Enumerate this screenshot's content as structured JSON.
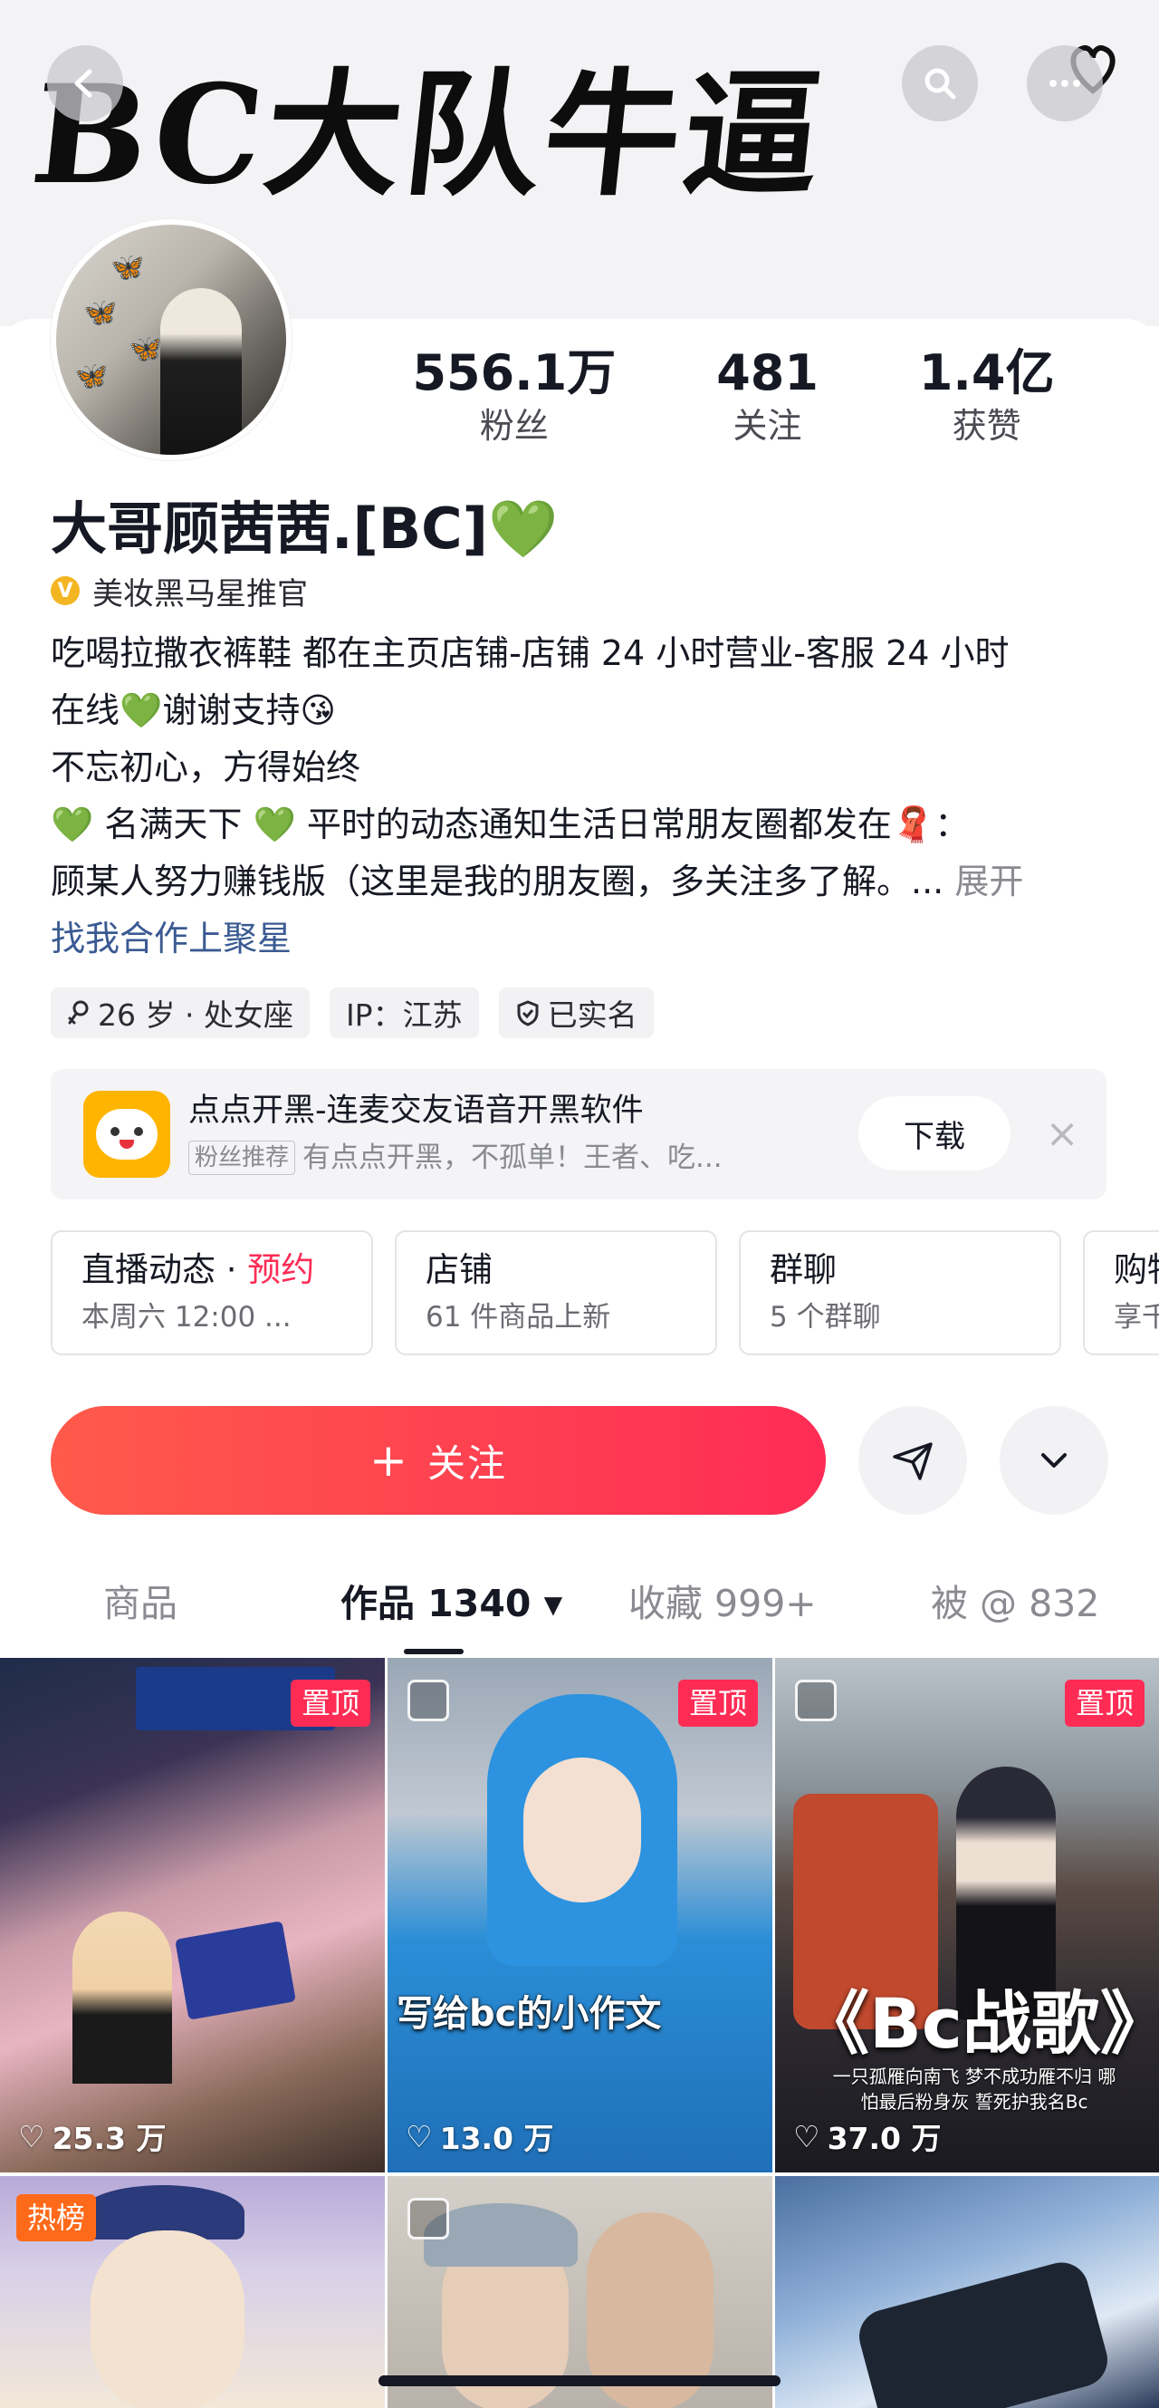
{
  "header": {
    "banner_text": "BC大队牛逼",
    "buttons": [
      "back-icon",
      "search-icon",
      "more-icon"
    ]
  },
  "stats": [
    {
      "value": "556.1万",
      "label": "粉丝"
    },
    {
      "value": "481",
      "label": "关注"
    },
    {
      "value": "1.4亿",
      "label": "获赞"
    }
  ],
  "profile": {
    "name": "大哥顾茜茜.[BC]",
    "name_emoji": "💚",
    "verify_badge": "V",
    "verify_text": "美妆黑马星推官",
    "bio": {
      "line1": "吃喝拉撒衣裤鞋 都在主页店铺-店铺 24 小时营业-客服 24 小时",
      "line2": "在线",
      "line2_emoji1": "💚",
      "line2_rest": "谢谢支持",
      "line2_emoji2": "😘",
      "line3": "不忘初心，方得始终",
      "line4_emoji": "💚",
      "line4_a": " 名满天下 ",
      "line4_b": " 平时的动态通知生活日常朋友圈都发在",
      "line4_emoji2": "🧣",
      "line4_c": "：",
      "line5": "顾某人努力赚钱版（这里是我的朋友圈，多关注多了解。...",
      "more": " 展开",
      "link": "找我合作上聚星"
    },
    "tags": [
      "26 岁 · 处女座",
      "IP：江苏",
      "已实名"
    ]
  },
  "promo": {
    "title": "点点开黑-连麦交友语音开黑软件",
    "badge": "粉丝推荐",
    "subtitle": "有点点开黑，不孤单！王者、吃...",
    "button": "下载",
    "close": "×"
  },
  "features": [
    {
      "title": "直播动态 · ",
      "highlight": "预约",
      "sub": "本周六 12:00 ..."
    },
    {
      "title": "店铺",
      "highlight": "",
      "sub": "61 件商品上新"
    },
    {
      "title": "群聊",
      "highlight": "",
      "sub": "5 个群聊"
    },
    {
      "title": "购物",
      "highlight": "",
      "sub": "享千"
    }
  ],
  "actions": {
    "follow": "关注",
    "follow_plus": "+"
  },
  "tabs": [
    {
      "label": "商品"
    },
    {
      "label": "作品 1340 ▾"
    },
    {
      "label": "收藏 999+"
    },
    {
      "label": "被 @ 832"
    }
  ],
  "videos": [
    {
      "pinned": "置顶",
      "likes": "25.3 万",
      "caption": ""
    },
    {
      "pinned": "置顶",
      "likes": "13.0 万",
      "caption": "写给bc的小作文"
    },
    {
      "pinned": "置顶",
      "likes": "37.0 万",
      "caption": "《Bc战歌》",
      "sub": "一只孤雁向南飞 梦不成功雁不归 哪怕最后粉身灰 誓死护我名Bc"
    },
    {
      "badge": "热榜"
    },
    {},
    {}
  ],
  "colors": {
    "accent": "#fe2c55",
    "verify": "#f3b622",
    "green_heart": "#21c43a",
    "link": "#3a5a92"
  }
}
